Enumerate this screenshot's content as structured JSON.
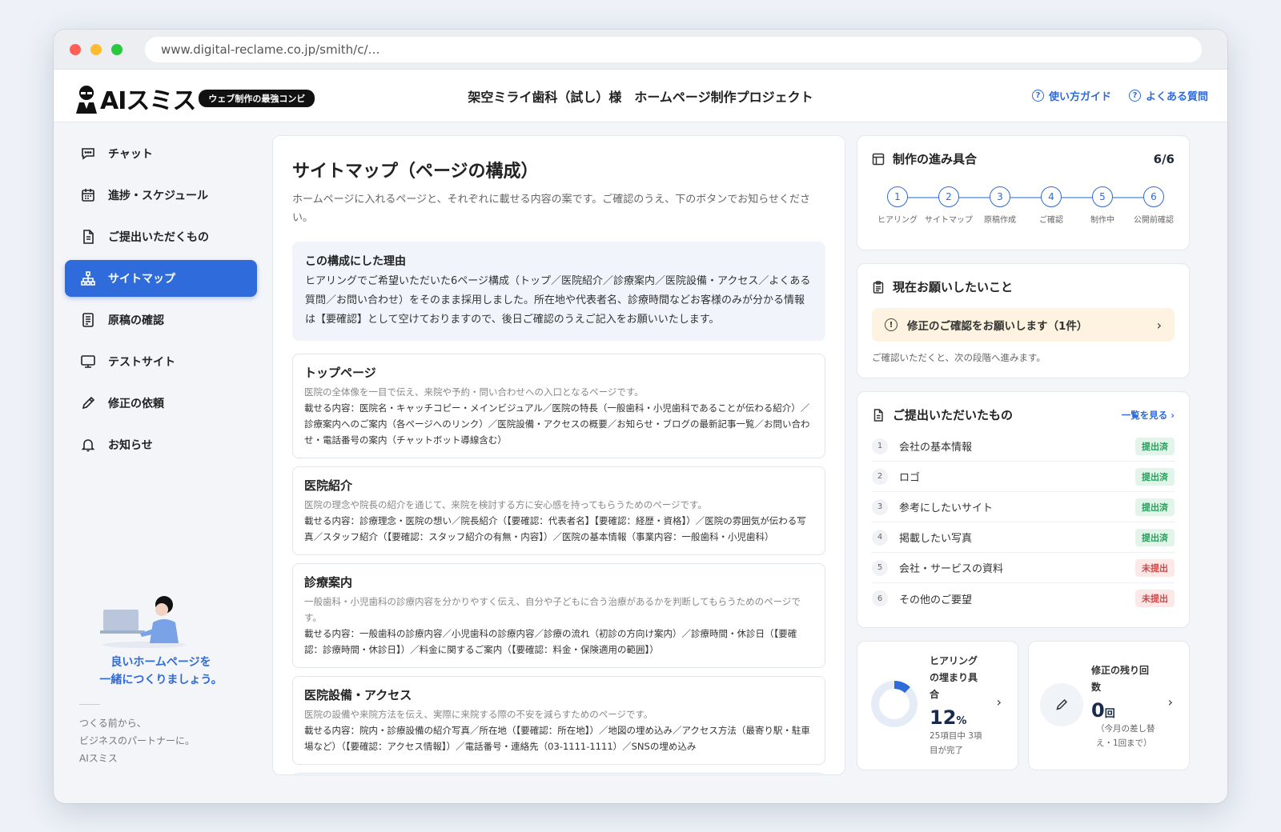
{
  "browser": {
    "url": "www.digital-reclame.co.jp/smith/c/…"
  },
  "header": {
    "logo_text": "AIスミス",
    "logo_tag": "ウェブ制作の最強コンビ",
    "project_title": "架空ミライ歯科（試し）様　ホームページ制作プロジェクト",
    "guide_link": "使い方ガイド",
    "faq_link": "よくある質問"
  },
  "sidebar": {
    "items": [
      {
        "label": "チャット",
        "icon": "chat-icon"
      },
      {
        "label": "進捗・スケジュール",
        "icon": "calendar-icon"
      },
      {
        "label": "ご提出いただくもの",
        "icon": "document-icon"
      },
      {
        "label": "サイトマップ",
        "icon": "sitemap-icon",
        "active": true
      },
      {
        "label": "原稿の確認",
        "icon": "manuscript-icon"
      },
      {
        "label": "テストサイト",
        "icon": "monitor-icon"
      },
      {
        "label": "修正の依頼",
        "icon": "pencil-icon"
      },
      {
        "label": "お知らせ",
        "icon": "bell-icon"
      }
    ],
    "message_line1": "良いホームページを",
    "message_line2": "一緒につくりましょう。",
    "footer_line1": "つくる前から、",
    "footer_line2": "ビジネスのパートナーに。",
    "footer_line3": "AIスミス"
  },
  "main": {
    "title": "サイトマップ（ページの構成）",
    "description": "ホームページに入れるページと、それぞれに載せる内容の案です。ご確認のうえ、下のボタンでお知らせください。",
    "reason_title": "この構成にした理由",
    "reason_text": "ヒアリングでご希望いただいた6ページ構成（トップ／医院紹介／診療案内／医院設備・アクセス／よくある質問／お問い合わせ）をそのまま採用しました。所在地や代表者名、診療時間などお客様のみが分かる情報は【要確認】として空けておりますので、後日ご確認のうえご記入をお願いいたします。",
    "pages": [
      {
        "name": "トップページ",
        "purpose": "医院の全体像を一目で伝え、来院や予約・問い合わせへの入口となるページです。",
        "content": "載せる内容：医院名・キャッチコピー・メインビジュアル／医院の特長（一般歯科・小児歯科であることが伝わる紹介）／診療案内へのご案内（各ページへのリンク）／医院設備・アクセスの概要／お知らせ・ブログの最新記事一覧／お問い合わせ・電話番号の案内（チャットボット導線含む）"
      },
      {
        "name": "医院紹介",
        "purpose": "医院の理念や院長の紹介を通じて、来院を検討する方に安心感を持ってもらうためのページです。",
        "content": "載せる内容：診療理念・医院の想い／院長紹介（【要確認：代表者名】【要確認：経歴・資格】）／医院の雰囲気が伝わる写真／スタッフ紹介（【要確認：スタッフ紹介の有無・内容】）／医院の基本情報（事業内容：一般歯科・小児歯科）"
      },
      {
        "name": "診療案内",
        "purpose": "一般歯科・小児歯科の診療内容を分かりやすく伝え、自分や子どもに合う治療があるかを判断してもらうためのページです。",
        "content": "載せる内容：一般歯科の診療内容／小児歯科の診療内容／診療の流れ（初診の方向け案内）／診療時間・休診日（【要確認：診療時間・休診日】）／料金に関するご案内（【要確認：料金・保険適用の範囲】）"
      },
      {
        "name": "医院設備・アクセス",
        "purpose": "医院の設備や来院方法を伝え、実際に来院する際の不安を減らすためのページです。",
        "content": "載せる内容：院内・診療設備の紹介写真／所在地（【要確認：所在地】）／地図の埋め込み／アクセス方法（最寄り駅・駐車場など）（【要確認：アクセス情報】）／電話番号・連絡先（03-1111-1111）／SNSの埋め込み"
      }
    ]
  },
  "progress": {
    "title": "制作の進み具合",
    "count": "6/6",
    "steps": [
      {
        "num": "1",
        "label": "ヒアリング"
      },
      {
        "num": "2",
        "label": "サイトマップ"
      },
      {
        "num": "3",
        "label": "原稿作成"
      },
      {
        "num": "4",
        "label": "ご確認"
      },
      {
        "num": "5",
        "label": "制作中"
      },
      {
        "num": "6",
        "label": "公開前確認"
      }
    ]
  },
  "request": {
    "title": "現在お願いしたいこと",
    "item": "修正のご確認をお願いします（1件）",
    "note": "ご確認いただくと、次の段階へ進みます。",
    "accent": "#fdf3e0"
  },
  "submissions": {
    "title": "ご提出いただいたもの",
    "see_all": "一覧を見る ›",
    "items": [
      {
        "num": "1",
        "label": "会社の基本情報",
        "status": "提出済",
        "done": true
      },
      {
        "num": "2",
        "label": "ロゴ",
        "status": "提出済",
        "done": true
      },
      {
        "num": "3",
        "label": "参考にしたいサイト",
        "status": "提出済",
        "done": true
      },
      {
        "num": "4",
        "label": "掲載したい写真",
        "status": "提出済",
        "done": true
      },
      {
        "num": "5",
        "label": "会社・サービスの資料",
        "status": "未提出",
        "done": false
      },
      {
        "num": "6",
        "label": "その他のご要望",
        "status": "未提出",
        "done": false
      }
    ]
  },
  "hearing": {
    "label_line1": "ヒアリング",
    "label_line2": "の埋まり具",
    "label_line3": "合",
    "percent": "12",
    "percent_unit": "%",
    "fill_fraction": 0.12,
    "sub_line1": "25項目中 3項",
    "sub_line2": "目が完了"
  },
  "revisions": {
    "label_line1": "修正の残り回",
    "label_line2": "数",
    "count": "0",
    "unit": "回",
    "sub_line1": "（今月の差し替",
    "sub_line2": "え・1回まで）"
  },
  "colors": {
    "primary": "#2f6bdb",
    "done": "#2a9d5b",
    "pending": "#d64545"
  }
}
